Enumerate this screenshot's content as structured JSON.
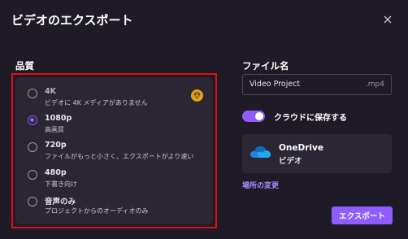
{
  "dialog": {
    "title": "ビデオのエクスポート"
  },
  "quality": {
    "label": "品質",
    "options": [
      {
        "name": "4K",
        "description": "ビデオに 4K メディアがありません",
        "selected": false,
        "disabled": true,
        "premium_icon": "premium-crown-icon"
      },
      {
        "name": "1080p",
        "description": "高画質",
        "selected": true,
        "disabled": false
      },
      {
        "name": "720p",
        "description": "ファイルがもっと小さく、エクスポートがより速い",
        "selected": false,
        "disabled": false
      },
      {
        "name": "480p",
        "description": "下書き向け",
        "selected": false,
        "disabled": false
      },
      {
        "name": "音声のみ",
        "description": "プロジェクトからのオーディオのみ",
        "selected": false,
        "disabled": false
      }
    ]
  },
  "filename": {
    "label": "ファイル名",
    "value": "Video Project",
    "extension": ".mp4"
  },
  "cloud": {
    "toggle_label": "クラウドに保存する",
    "toggle_on": true,
    "service_name": "OneDrive",
    "service_sub": "ビデオ",
    "icon": "onedrive-cloud-icon"
  },
  "change_location_label": "場所の変更",
  "export_label": "エクスポート",
  "colors": {
    "background": "#1f1b26",
    "panel": "#2a2633",
    "accent": "#8f5cff",
    "highlight_border": "#e01010",
    "premium": "#e0a21a"
  }
}
